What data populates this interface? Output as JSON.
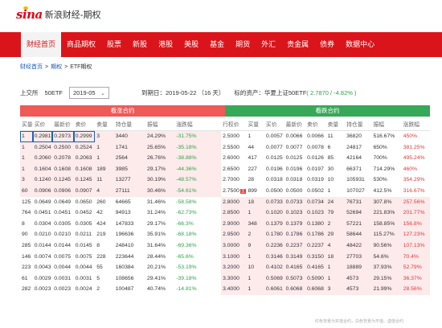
{
  "header": {
    "logo_mark": "sina",
    "logo_text": "新浪财经-期权"
  },
  "nav": {
    "items": [
      {
        "label": "财经首页",
        "active": true
      },
      {
        "label": "商品期权",
        "active": false
      },
      {
        "label": "股票",
        "active": false
      },
      {
        "label": "新股",
        "active": false
      },
      {
        "label": "港股",
        "active": false
      },
      {
        "label": "美股",
        "active": false
      },
      {
        "label": "基金",
        "active": false
      },
      {
        "label": "期货",
        "active": false
      },
      {
        "label": "外汇",
        "active": false
      },
      {
        "label": "贵金属",
        "active": false
      },
      {
        "label": "债券",
        "active": false
      },
      {
        "label": "数据中心",
        "active": false
      }
    ]
  },
  "breadcrumb": {
    "items": [
      "财经首页",
      "期权",
      "ETF期权"
    ]
  },
  "filter": {
    "exchange": "上交所",
    "product": "50ETF",
    "month": "2019-05",
    "expire": "到期日：2019-05-22 （16 天）",
    "underlying_label": "标的资产：华夏上证50ETF",
    "underlying_value": "( 2.7870 / -4.82% )"
  },
  "sections": {
    "call": "看涨合约",
    "put": "看跌合约"
  },
  "columns": {
    "call": [
      "买量",
      "买价",
      "最新价",
      "卖价",
      "卖量",
      "持仓量",
      "振幅",
      "涨跌幅"
    ],
    "put": [
      "行权价",
      "买量",
      "买价",
      "最新价",
      "卖价",
      "卖量",
      "持仓量",
      "振幅",
      "涨跌幅"
    ]
  },
  "rows": [
    {
      "call": [
        "1",
        "0.2981",
        "0.2973",
        "0.2999",
        "3",
        "3440",
        "24.29%",
        "-31.75%"
      ],
      "strike": "2.5000",
      "flag": "",
      "put": [
        "1",
        "0.0057",
        "0.0066",
        "0.0066",
        "11",
        "36820",
        "516.67%",
        "450%"
      ]
    },
    {
      "call": [
        "1",
        "0.2504",
        "0.2500",
        "0.2524",
        "1",
        "1741",
        "25.65%",
        "-35.18%"
      ],
      "strike": "2.5500",
      "flag": "",
      "put": [
        "44",
        "0.0077",
        "0.0077",
        "0.0078",
        "6",
        "24817",
        "650%",
        "381.25%"
      ]
    },
    {
      "call": [
        "1",
        "0.2060",
        "0.2078",
        "0.2063",
        "1",
        "2564",
        "26.76%",
        "-38.88%"
      ],
      "strike": "2.6000",
      "flag": "",
      "put": [
        "417",
        "0.0125",
        "0.0125",
        "0.0126",
        "85",
        "42164",
        "700%",
        "495.24%"
      ]
    },
    {
      "call": [
        "1",
        "0.1604",
        "0.1608",
        "0.1608",
        "189",
        "3985",
        "29.17%",
        "-44.36%"
      ],
      "strike": "2.6500",
      "flag": "",
      "put": [
        "227",
        "0.0196",
        "0.0196",
        "0.0197",
        "30",
        "66371",
        "714.29%",
        "460%"
      ]
    },
    {
      "call": [
        "3",
        "0.1240",
        "0.1245",
        "0.1245",
        "11",
        "13277",
        "30.19%",
        "-48.57%"
      ],
      "strike": "2.7000",
      "flag": "",
      "put": [
        "28",
        "0.0318",
        "0.0318",
        "0.0319",
        "10",
        "105931",
        "530%",
        "354.29%"
      ]
    },
    {
      "call": [
        "60",
        "0.0906",
        "0.0906",
        "0.0907",
        "4",
        "27111",
        "30.46%",
        "-54.61%"
      ],
      "strike": "2.7500",
      "flag": "主",
      "put": [
        "899",
        "0.0500",
        "0.0500",
        "0.0502",
        "1",
        "107027",
        "412.5%",
        "316.67%"
      ]
    },
    {
      "call": [
        "125",
        "0.0649",
        "0.0649",
        "0.0650",
        "260",
        "64665",
        "31.46%",
        "-58.58%"
      ],
      "strike": "2.8000",
      "flag": "",
      "put": [
        "18",
        "0.0733",
        "0.0733",
        "0.0734",
        "24",
        "76731",
        "307.8%",
        "257.56%"
      ]
    },
    {
      "call": [
        "764",
        "0.0451",
        "0.0451",
        "0.0452",
        "42",
        "94913",
        "31.24%",
        "-62.73%"
      ],
      "strike": "2.8500",
      "flag": "",
      "put": [
        "1",
        "0.1020",
        "0.1023",
        "0.1023",
        "79",
        "52694",
        "221.83%",
        "201.77%"
      ]
    },
    {
      "call": [
        "8",
        "0.0304",
        "0.0305",
        "0.0305",
        "424",
        "147833",
        "29.17%",
        "-66.3%"
      ],
      "strike": "2.9000",
      "flag": "",
      "put": [
        "348",
        "0.1379",
        "0.1379",
        "0.1380",
        "2",
        "57221",
        "158.85%",
        "156.8%"
      ]
    },
    {
      "call": [
        "90",
        "0.0210",
        "0.0210",
        "0.0211",
        "219",
        "196636",
        "35.91%",
        "-68.18%"
      ],
      "strike": "2.9500",
      "flag": "",
      "put": [
        "2",
        "0.1780",
        "0.1786",
        "0.1786",
        "29",
        "58644",
        "115.27%",
        "127.23%"
      ]
    },
    {
      "call": [
        "285",
        "0.0144",
        "0.0144",
        "0.0145",
        "8",
        "248410",
        "31.64%",
        "-69.36%"
      ],
      "strike": "3.0000",
      "flag": "",
      "put": [
        "9",
        "0.2236",
        "0.2237",
        "0.2237",
        "4",
        "48422",
        "90.56%",
        "107.13%"
      ]
    },
    {
      "call": [
        "146",
        "0.0074",
        "0.0075",
        "0.0075",
        "228",
        "223644",
        "28.44%",
        "-65.6%"
      ],
      "strike": "3.1000",
      "flag": "",
      "put": [
        "1",
        "0.3146",
        "0.3149",
        "0.3150",
        "18",
        "27703",
        "54.6%",
        "70.4%"
      ]
    },
    {
      "call": [
        "223",
        "0.0043",
        "0.0044",
        "0.0044",
        "55",
        "160384",
        "20.21%",
        "-53.19%"
      ],
      "strike": "3.2000",
      "flag": "",
      "put": [
        "10",
        "0.4102",
        "0.4165",
        "0.4165",
        "1",
        "18889",
        "37.93%",
        "52.79%"
      ]
    },
    {
      "call": [
        "61",
        "0.0029",
        "0.0031",
        "0.0031",
        "5",
        "108656",
        "29.41%",
        "-39.18%"
      ],
      "strike": "3.3000",
      "flag": "",
      "put": [
        "1",
        "0.5069",
        "0.5073",
        "0.5090",
        "1",
        "4573",
        "29.15%",
        "36.37%"
      ]
    },
    {
      "call": [
        "282",
        "0.0023",
        "0.0023",
        "0.0024",
        "2",
        "100487",
        "40.74%",
        "-14.81%"
      ],
      "strike": "3.4000",
      "flag": "",
      "put": [
        "1",
        "0.6061",
        "0.6068",
        "0.6068",
        "3",
        "4573",
        "21.99%",
        "28.56%"
      ]
    }
  ],
  "colors": {
    "nav_bg": "#d9151b",
    "call_bar": "#ee5a55",
    "put_bar": "#36a858",
    "pink_row": "#fdeaeb",
    "negative": "#2ba644",
    "positive": "#e13838"
  },
  "footnote": "红色背景为实值合约，白色背景为平值、虚值合约"
}
